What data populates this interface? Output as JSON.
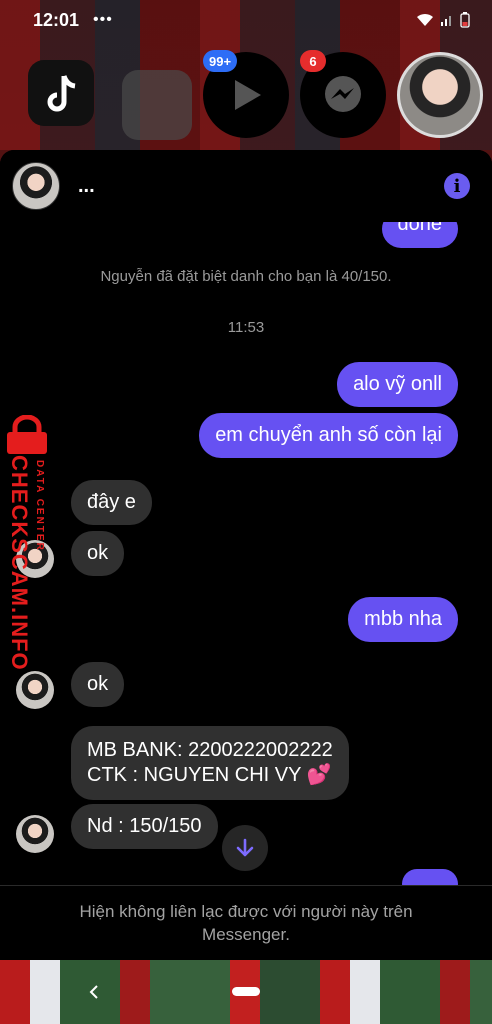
{
  "status_bar": {
    "time": "12:01",
    "overflow": "•••"
  },
  "chat_heads": {
    "video_badge": "99+",
    "messenger_badge": "6"
  },
  "header": {
    "name": "..."
  },
  "messages": {
    "partial_top": "done",
    "nickname_notice": "Nguyễn đã đặt biệt danh cho bạn là 40/150.",
    "timestamp": "11:53",
    "m1": "alo vỹ onll",
    "m2": "em chuyển anh số còn lại",
    "m3": "đây e",
    "m4": "ok",
    "m5": "mbb nha",
    "m6": "ok",
    "m7_line1": "MB BANK: 2200222002222",
    "m7_line2": "CTK : NGUYEN CHI VY",
    "m7_emoji": "💕",
    "m8": "Nd : 150/150"
  },
  "footer": {
    "line1": "Hiện không liên lạc được với người này trên",
    "line2": "Messenger."
  },
  "watermark": {
    "brand": "CHECKSCAM.INFO",
    "sub": "DATA CENTER"
  },
  "colors": {
    "sent_bubble": "#6651f2",
    "recv_bubble": "#303030",
    "accent": "#6a5cf0"
  },
  "icons": [
    "wifi-icon",
    "signal-icon",
    "battery-icon",
    "tiktok-icon",
    "play-icon",
    "messenger-icon",
    "info-icon",
    "arrow-down-icon",
    "lock-icon",
    "back-chevron-icon"
  ]
}
